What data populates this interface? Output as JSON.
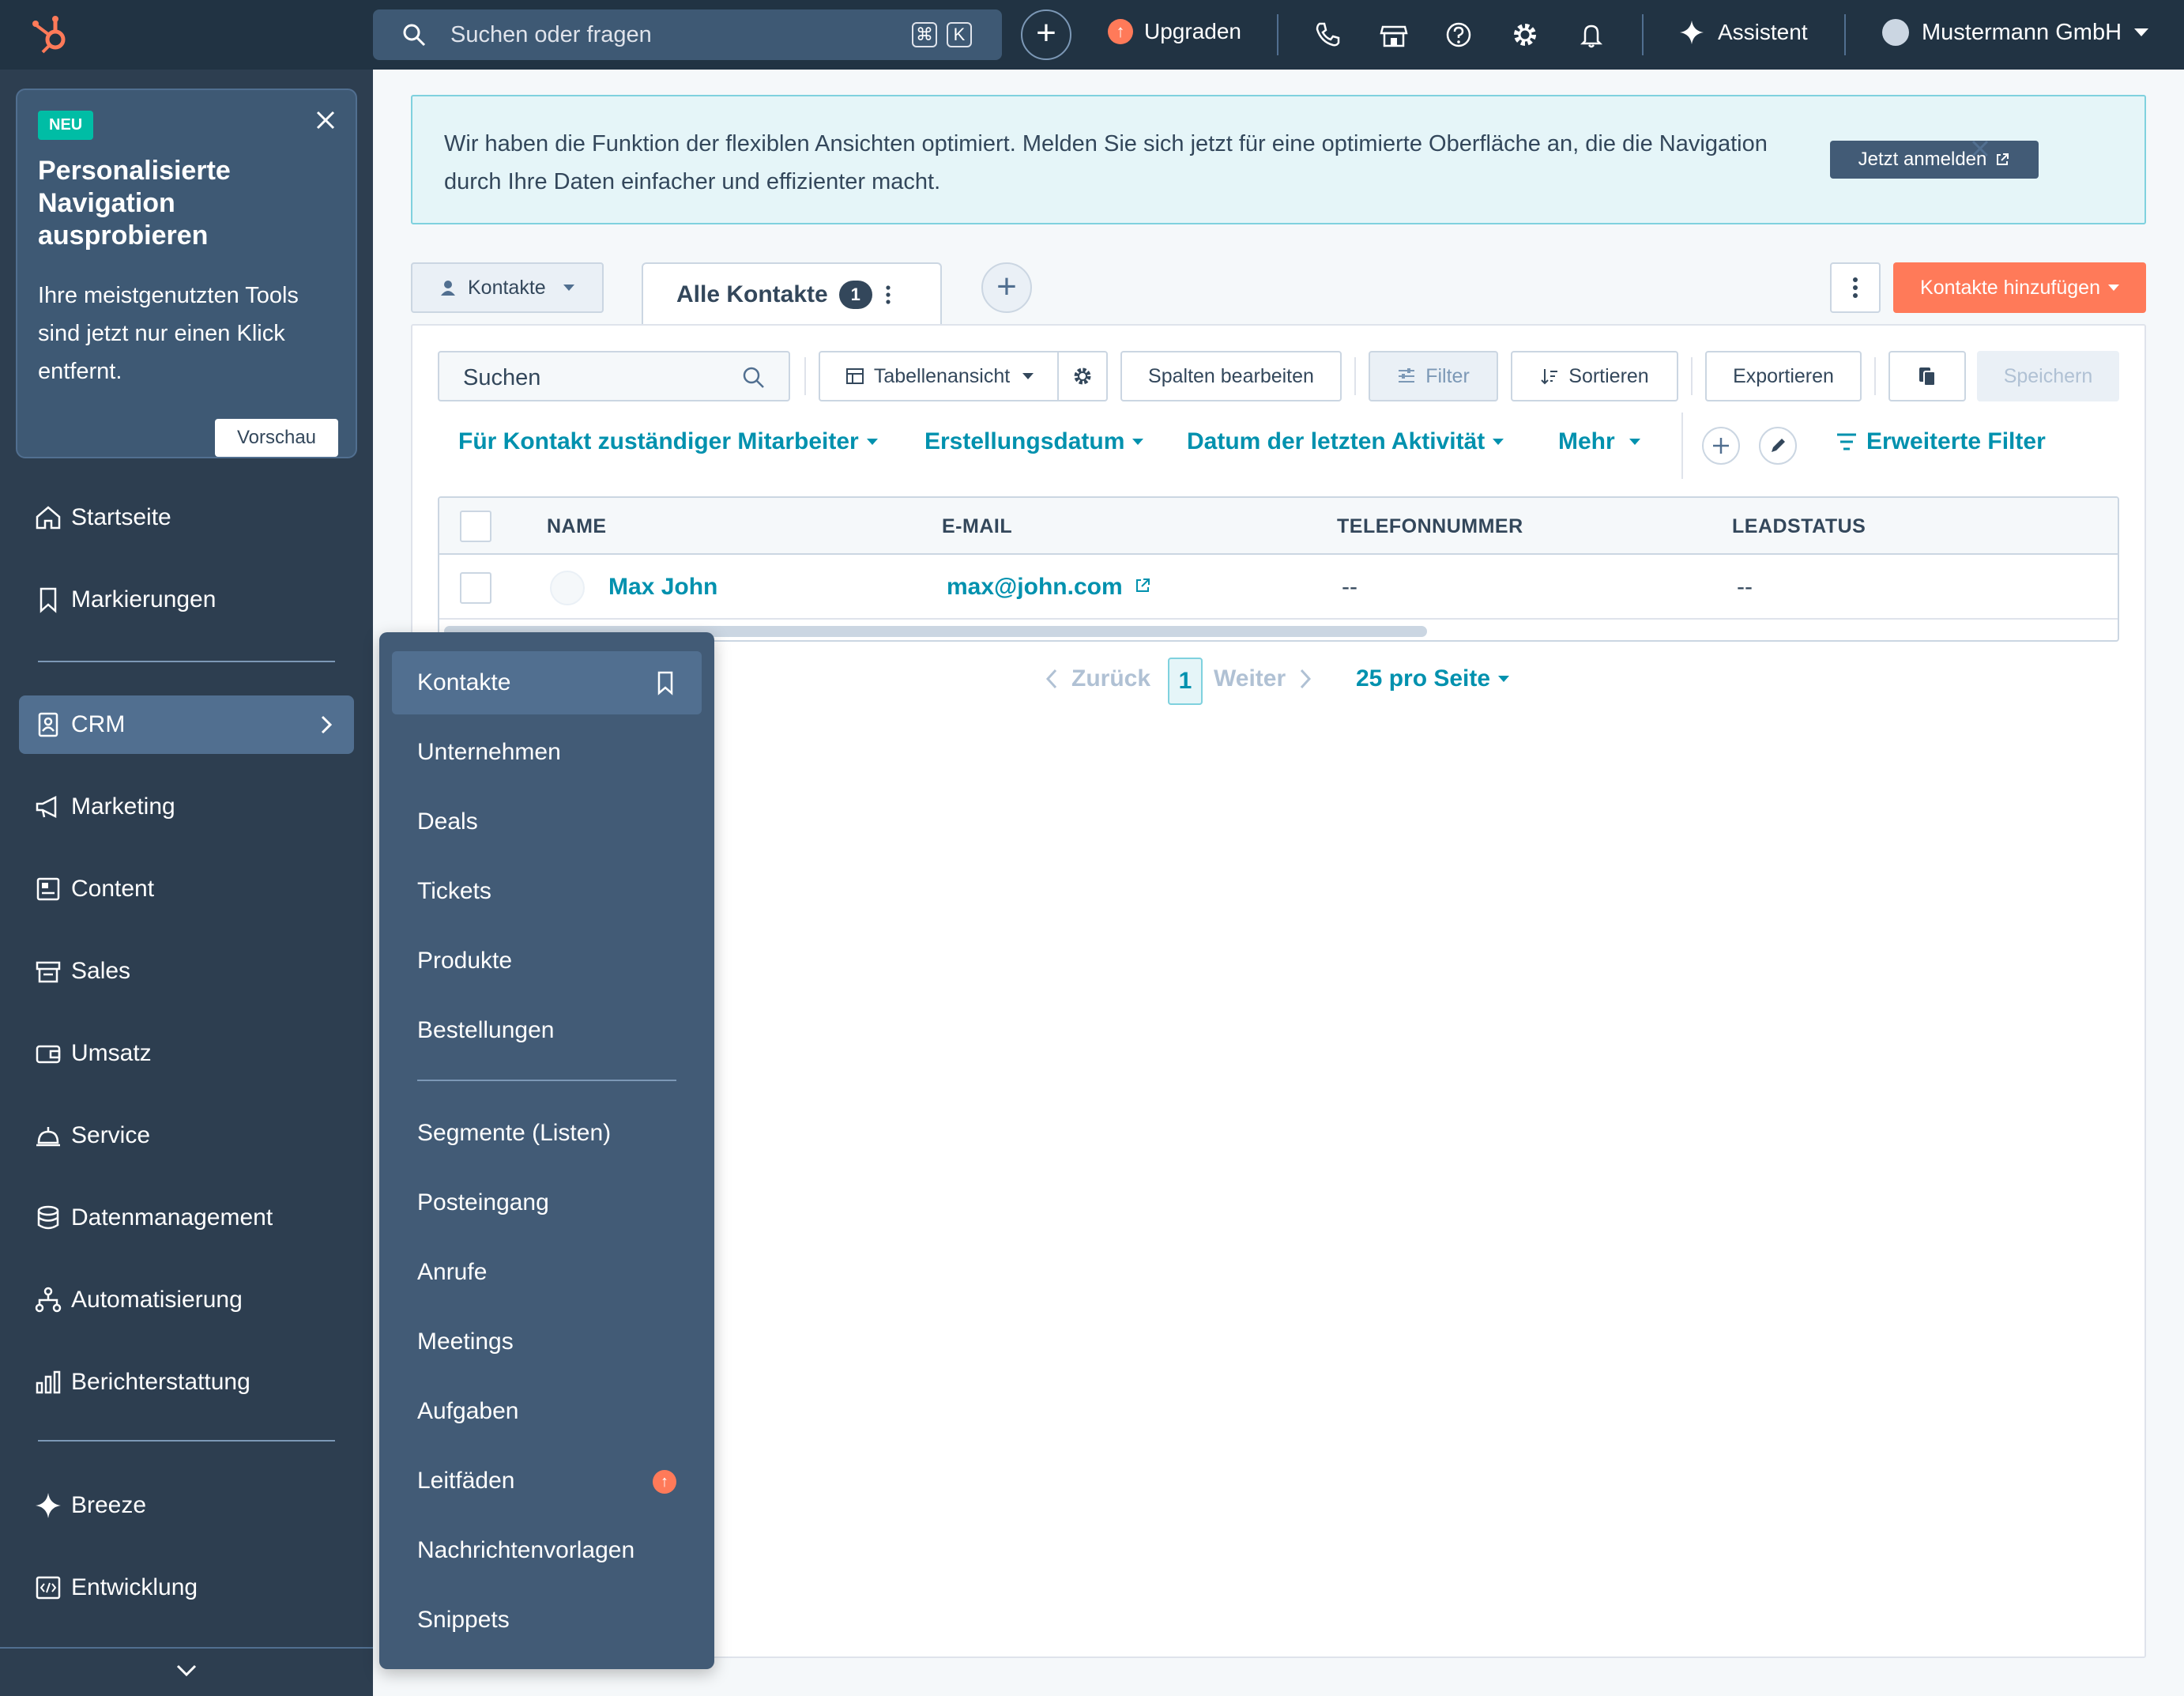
{
  "topbar": {
    "search_placeholder": "Suchen oder fragen",
    "shortcut_cmd": "⌘",
    "shortcut_k": "K",
    "create_symbol": "+",
    "upgrade_label": "Upgraden",
    "assistant_label": "Assistent",
    "account_name": "Mustermann GmbH"
  },
  "promo": {
    "badge": "NEU",
    "title": "Personalisierte Navigation ausprobieren",
    "body": "Ihre meistgenutzten Tools sind jetzt nur einen Klick entfernt.",
    "button": "Vorschau"
  },
  "sidebar": {
    "items": [
      {
        "label": "Startseite",
        "icon": "home-icon"
      },
      {
        "label": "Markierungen",
        "icon": "bookmark-icon"
      },
      {
        "label": "CRM",
        "icon": "crm-icon",
        "active": true
      },
      {
        "label": "Marketing",
        "icon": "megaphone-icon"
      },
      {
        "label": "Content",
        "icon": "content-icon"
      },
      {
        "label": "Sales",
        "icon": "sales-icon"
      },
      {
        "label": "Umsatz",
        "icon": "wallet-icon"
      },
      {
        "label": "Service",
        "icon": "bell-service-icon"
      },
      {
        "label": "Datenmanagement",
        "icon": "database-icon"
      },
      {
        "label": "Automatisierung",
        "icon": "automation-icon"
      },
      {
        "label": "Berichterstattung",
        "icon": "report-icon"
      },
      {
        "label": "Breeze",
        "icon": "sparkle-icon"
      },
      {
        "label": "Entwicklung",
        "icon": "code-icon"
      }
    ]
  },
  "banner": {
    "text": "Wir haben die Funktion der flexiblen Ansichten optimiert. Melden Sie sich jetzt für eine optimierte Oberfläche an, die die Navigation durch Ihre Daten einfacher und effizienter macht.",
    "button": "Jetzt anmelden"
  },
  "header": {
    "object_selector": "Kontakte",
    "tab_label": "Alle Kontakte",
    "tab_count": "1",
    "add_tab_symbol": "+",
    "add_button": "Kontakte hinzufügen"
  },
  "toolbar": {
    "search_placeholder": "Suchen",
    "view_label": "Tabellenansicht",
    "edit_columns": "Spalten bearbeiten",
    "filter": "Filter",
    "sort": "Sortieren",
    "export": "Exportieren",
    "save": "Speichern"
  },
  "filters": {
    "owner": "Für Kontakt zuständiger Mitarbeiter",
    "created": "Erstellungsdatum",
    "last_activity": "Datum der letzten Aktivität",
    "more": "Mehr",
    "advanced": "Erweiterte Filter"
  },
  "table": {
    "columns": [
      "NAME",
      "E-MAIL",
      "TELEFONNUMMER",
      "LEADSTATUS"
    ],
    "rows": [
      {
        "name": "Max John",
        "email": "max@john.com",
        "phone": "--",
        "lead_status": "--"
      }
    ]
  },
  "pagination": {
    "prev": "Zurück",
    "page": "1",
    "next": "Weiter",
    "per_page": "25 pro Seite"
  },
  "flyout": {
    "group1": [
      "Kontakte",
      "Unternehmen",
      "Deals",
      "Tickets",
      "Produkte",
      "Bestellungen"
    ],
    "group2": [
      "Segmente (Listen)",
      "Posteingang",
      "Anrufe",
      "Meetings",
      "Aufgaben",
      "Leitfäden",
      "Nachrichtenvorlagen",
      "Snippets"
    ]
  },
  "colors": {
    "topbar": "#213343",
    "sidebar": "#2d3e50",
    "flyout": "#425b76",
    "accent_orange": "#ff7a59",
    "link_teal": "#0091ae"
  }
}
